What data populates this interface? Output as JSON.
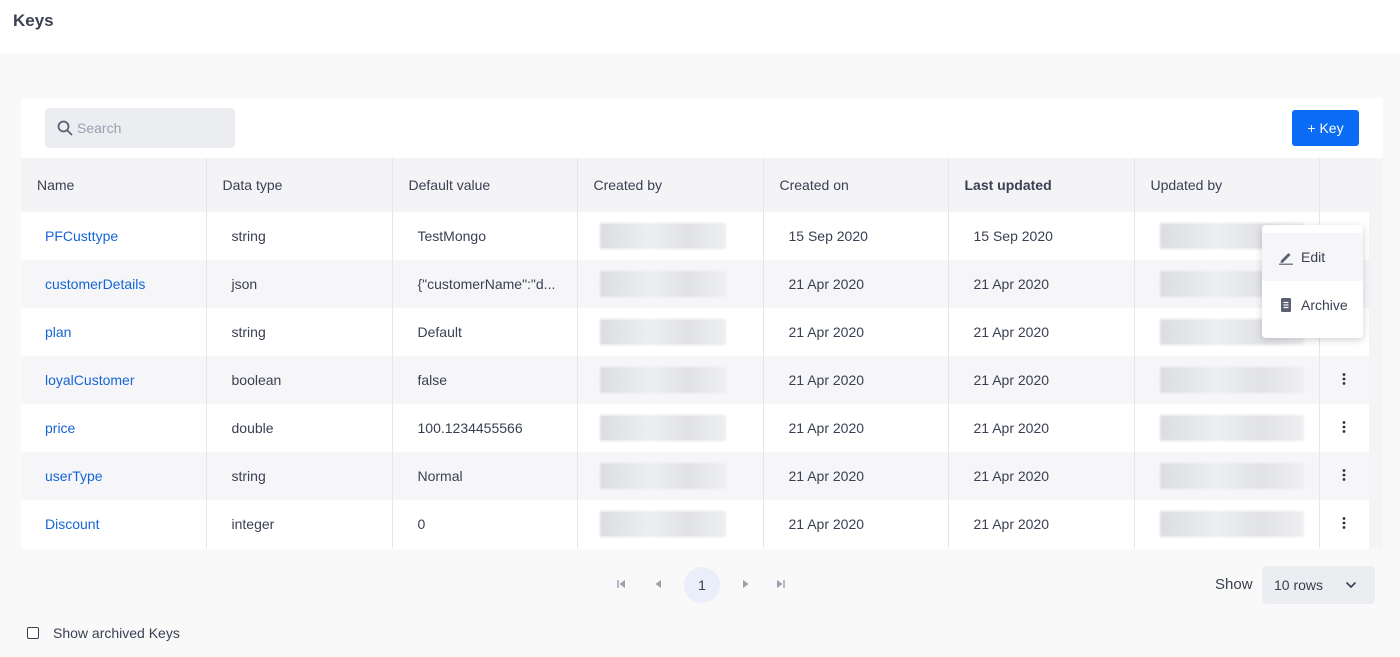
{
  "page": {
    "title": "Keys"
  },
  "toolbar": {
    "search_placeholder": "Search",
    "add_label": "+ Key"
  },
  "table": {
    "headers": [
      "Name",
      "Data type",
      "Default value",
      "Created by",
      "Created on",
      "Last updated",
      "Updated by"
    ],
    "rows": [
      {
        "name": "PFCusttype",
        "data_type": "string",
        "default_value": "TestMongo",
        "created_on": "15 Sep 2020",
        "last_updated": "15 Sep 2020"
      },
      {
        "name": "customerDetails",
        "data_type": "json",
        "default_value": "{\"customerName\":\"d...",
        "created_on": "21 Apr 2020",
        "last_updated": "21 Apr 2020"
      },
      {
        "name": "plan",
        "data_type": "string",
        "default_value": "Default",
        "created_on": "21 Apr 2020",
        "last_updated": "21 Apr 2020"
      },
      {
        "name": "loyalCustomer",
        "data_type": "boolean",
        "default_value": "false",
        "created_on": "21 Apr 2020",
        "last_updated": "21 Apr 2020"
      },
      {
        "name": "price",
        "data_type": "double",
        "default_value": "100.1234455566",
        "created_on": "21 Apr 2020",
        "last_updated": "21 Apr 2020"
      },
      {
        "name": "userType",
        "data_type": "string",
        "default_value": "Normal",
        "created_on": "21 Apr 2020",
        "last_updated": "21 Apr 2020"
      },
      {
        "name": "Discount",
        "data_type": "integer",
        "default_value": "0",
        "created_on": "21 Apr 2020",
        "last_updated": "21 Apr 2020"
      }
    ]
  },
  "row_menu": {
    "edit_label": "Edit",
    "archive_label": "Archive"
  },
  "pagination": {
    "current_page": "1",
    "show_label": "Show",
    "rows_value": "10 rows"
  },
  "footer": {
    "show_archived_label": "Show archived Keys",
    "show_archived_checked": false
  },
  "colors": {
    "accent": "#0a6cf5",
    "link": "#1565d8",
    "text": "#3a3f51"
  },
  "icons": [
    "search-icon",
    "kebab-menu-icon",
    "pencil-icon",
    "archive-icon",
    "first-page-icon",
    "prev-page-icon",
    "next-page-icon",
    "last-page-icon",
    "chevron-down-icon"
  ]
}
